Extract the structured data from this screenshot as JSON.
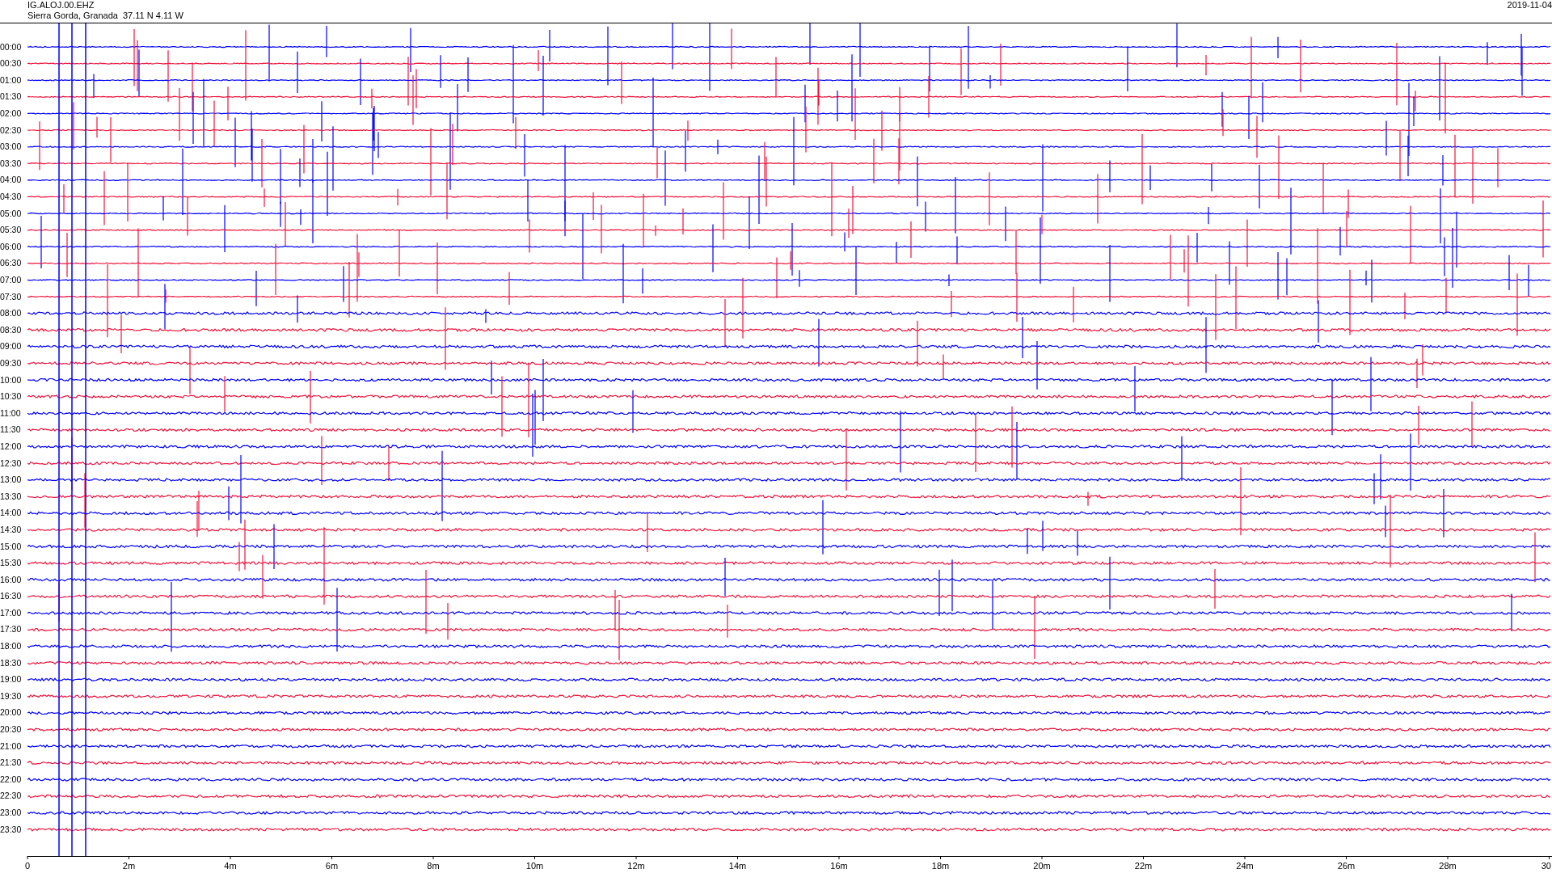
{
  "header": {
    "station": "IG.ALOJ.00.EHZ",
    "location": "Sierra Gorda, Granada  37.11 N 4.11 W",
    "date": "2019-11-04"
  },
  "rows": [
    {
      "time": "00:00",
      "color": "#0000ff"
    },
    {
      "time": "00:30",
      "color": "#f0143c"
    },
    {
      "time": "01:00",
      "color": "#0000ff"
    },
    {
      "time": "01:30",
      "color": "#f0143c"
    },
    {
      "time": "02:00",
      "color": "#0000ff"
    },
    {
      "time": "02:30",
      "color": "#f0143c"
    },
    {
      "time": "03:00",
      "color": "#0000ff"
    },
    {
      "time": "03:30",
      "color": "#f0143c"
    },
    {
      "time": "04:00",
      "color": "#0000ff"
    },
    {
      "time": "04:30",
      "color": "#f0143c"
    },
    {
      "time": "05:00",
      "color": "#0000ff"
    },
    {
      "time": "05:30",
      "color": "#f0143c"
    },
    {
      "time": "06:00",
      "color": "#0000ff"
    },
    {
      "time": "06:30",
      "color": "#f0143c"
    },
    {
      "time": "07:00",
      "color": "#0000ff"
    },
    {
      "time": "07:30",
      "color": "#f0143c"
    },
    {
      "time": "08:00",
      "color": "#0000ff"
    },
    {
      "time": "08:30",
      "color": "#f0143c"
    },
    {
      "time": "09:00",
      "color": "#0000ff"
    },
    {
      "time": "09:30",
      "color": "#f0143c"
    },
    {
      "time": "10:00",
      "color": "#0000ff"
    },
    {
      "time": "10:30",
      "color": "#f0143c"
    },
    {
      "time": "11:00",
      "color": "#0000ff"
    },
    {
      "time": "11:30",
      "color": "#f0143c"
    },
    {
      "time": "12:00",
      "color": "#0000ff"
    },
    {
      "time": "12:30",
      "color": "#f0143c"
    },
    {
      "time": "13:00",
      "color": "#0000ff"
    },
    {
      "time": "13:30",
      "color": "#f0143c"
    },
    {
      "time": "14:00",
      "color": "#0000ff"
    },
    {
      "time": "14:30",
      "color": "#f0143c"
    },
    {
      "time": "15:00",
      "color": "#0000ff"
    },
    {
      "time": "15:30",
      "color": "#f0143c"
    },
    {
      "time": "16:00",
      "color": "#0000ff"
    },
    {
      "time": "16:30",
      "color": "#f0143c"
    },
    {
      "time": "17:00",
      "color": "#0000ff"
    },
    {
      "time": "17:30",
      "color": "#f0143c"
    },
    {
      "time": "18:00",
      "color": "#0000ff"
    },
    {
      "time": "18:30",
      "color": "#f0143c"
    },
    {
      "time": "19:00",
      "color": "#0000ff"
    },
    {
      "time": "19:30",
      "color": "#f0143c"
    },
    {
      "time": "20:00",
      "color": "#0000ff"
    },
    {
      "time": "20:30",
      "color": "#f0143c"
    },
    {
      "time": "21:00",
      "color": "#0000ff"
    },
    {
      "time": "21:30",
      "color": "#f0143c"
    },
    {
      "time": "22:00",
      "color": "#0000ff"
    },
    {
      "time": "22:30",
      "color": "#f0143c"
    },
    {
      "time": "23:00",
      "color": "#0000ff"
    },
    {
      "time": "23:30",
      "color": "#f0143c"
    }
  ],
  "x_axis": {
    "ticks": [
      "0",
      "2m",
      "4m",
      "6m",
      "8m",
      "10m",
      "12m",
      "14m",
      "16m",
      "18m",
      "20m",
      "22m",
      "24m",
      "26m",
      "28m",
      "30"
    ]
  }
}
